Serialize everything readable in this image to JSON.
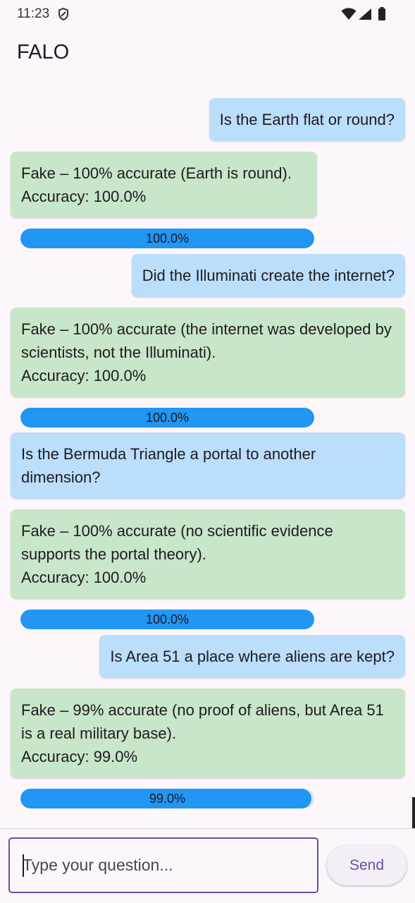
{
  "status_bar": {
    "time": "11:23"
  },
  "app_bar": {
    "title": "FALO"
  },
  "messages": [
    {
      "role": "user",
      "text": "Is the Earth flat or round?"
    },
    {
      "role": "bot",
      "text": "Fake – 100% accurate (Earth is round).\nAccuracy: 100.0%",
      "accuracy_label": "100.0%",
      "accuracy_fraction": 1.0
    },
    {
      "role": "user",
      "text": "Did the Illuminati create the internet?"
    },
    {
      "role": "bot",
      "text": "Fake – 100% accurate (the internet was developed by scientists, not the Illuminati).\nAccuracy: 100.0%",
      "accuracy_label": "100.0%",
      "accuracy_fraction": 1.0
    },
    {
      "role": "user",
      "text": "Is the Bermuda Triangle a portal to another dimension?"
    },
    {
      "role": "bot",
      "text": "Fake – 100% accurate (no scientific evidence supports the portal theory).\nAccuracy: 100.0%",
      "accuracy_label": "100.0%",
      "accuracy_fraction": 1.0
    },
    {
      "role": "user",
      "text": "Is Area 51 a place where aliens are kept?"
    },
    {
      "role": "bot",
      "text": "Fake – 99% accurate (no proof of aliens, but Area 51 is a real military base).\nAccuracy: 99.0%",
      "accuracy_label": "99.0%",
      "accuracy_fraction": 0.99
    }
  ],
  "composer": {
    "placeholder": "Type your question...",
    "value": "",
    "send_label": "Send"
  },
  "colors": {
    "user_bubble": "#bbdefb",
    "bot_bubble": "#c8e6c9",
    "progress": "#2196f3",
    "accent": "#6750a4"
  }
}
